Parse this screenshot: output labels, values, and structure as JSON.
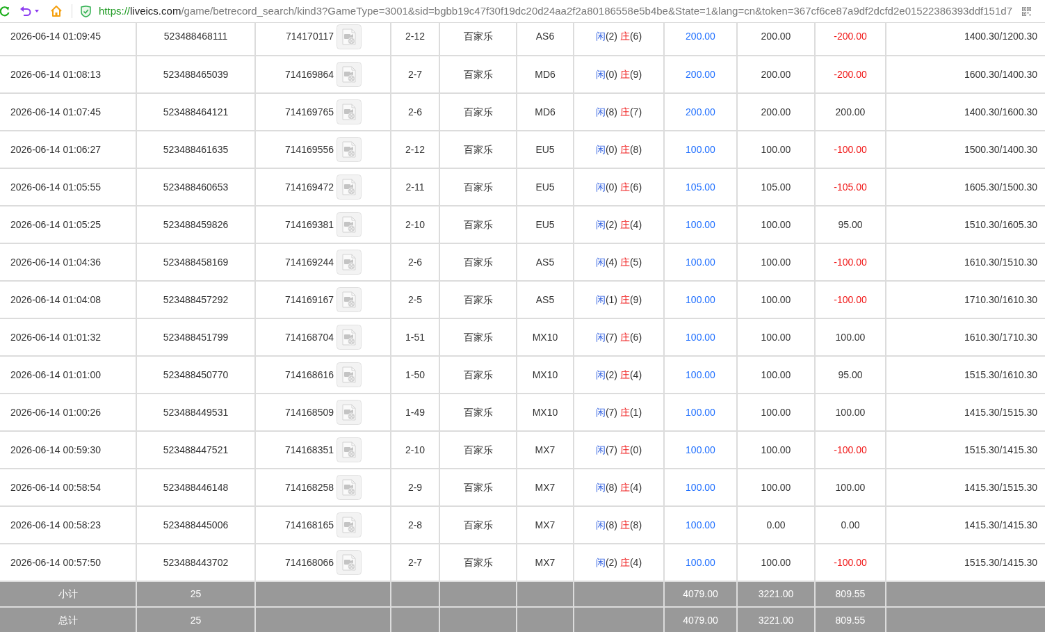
{
  "browser": {
    "url": {
      "scheme": "https://",
      "host": "liveics.com",
      "rest": "/game/betrecord_search/kind3?GameType=3001&sid=bgbb19c47f30f19dc20d24aa2f2a80186558e5b4be&State=1&lang=cn&token=367cf6ce87a9df2dcfd2e01522386393ddf151d7"
    }
  },
  "rows": [
    {
      "column_1": "2026-06-14 01:09:45",
      "column_2": "523488468111",
      "column_3": "714170117",
      "column_4": "2-12",
      "column_5": "百家乐",
      "column_6": "AS6",
      "column_7": {
        "player": "闲",
        "player_points": "(2)",
        "banker": "庄",
        "banker_points": "(6)"
      },
      "column_8": "200.00",
      "column_9": "200.00",
      "column_10": {
        "text": "-200.00",
        "loss": true
      },
      "column_11": "1400.30/1200.30"
    },
    {
      "column_1": "2026-06-14 01:08:13",
      "column_2": "523488465039",
      "column_3": "714169864",
      "column_4": "2-7",
      "column_5": "百家乐",
      "column_6": "MD6",
      "column_7": {
        "player": "闲",
        "player_points": "(0)",
        "banker": "庄",
        "banker_points": "(9)"
      },
      "column_8": "200.00",
      "column_9": "200.00",
      "column_10": {
        "text": "-200.00",
        "loss": true
      },
      "column_11": "1600.30/1400.30"
    },
    {
      "column_1": "2026-06-14 01:07:45",
      "column_2": "523488464121",
      "column_3": "714169765",
      "column_4": "2-6",
      "column_5": "百家乐",
      "column_6": "MD6",
      "column_7": {
        "player": "闲",
        "player_points": "(8)",
        "banker": "庄",
        "banker_points": "(7)"
      },
      "column_8": "200.00",
      "column_9": "200.00",
      "column_10": {
        "text": "200.00",
        "loss": false
      },
      "column_11": "1400.30/1600.30"
    },
    {
      "column_1": "2026-06-14 01:06:27",
      "column_2": "523488461635",
      "column_3": "714169556",
      "column_4": "2-12",
      "column_5": "百家乐",
      "column_6": "EU5",
      "column_7": {
        "player": "闲",
        "player_points": "(0)",
        "banker": "庄",
        "banker_points": "(8)"
      },
      "column_8": "100.00",
      "column_9": "100.00",
      "column_10": {
        "text": "-100.00",
        "loss": true
      },
      "column_11": "1500.30/1400.30"
    },
    {
      "column_1": "2026-06-14 01:05:55",
      "column_2": "523488460653",
      "column_3": "714169472",
      "column_4": "2-11",
      "column_5": "百家乐",
      "column_6": "EU5",
      "column_7": {
        "player": "闲",
        "player_points": "(0)",
        "banker": "庄",
        "banker_points": "(6)"
      },
      "column_8": "105.00",
      "column_9": "105.00",
      "column_10": {
        "text": "-105.00",
        "loss": true
      },
      "column_11": "1605.30/1500.30"
    },
    {
      "column_1": "2026-06-14 01:05:25",
      "column_2": "523488459826",
      "column_3": "714169381",
      "column_4": "2-10",
      "column_5": "百家乐",
      "column_6": "EU5",
      "column_7": {
        "player": "闲",
        "player_points": "(2)",
        "banker": "庄",
        "banker_points": "(4)"
      },
      "column_8": "100.00",
      "column_9": "100.00",
      "column_10": {
        "text": "95.00",
        "loss": false
      },
      "column_11": "1510.30/1605.30"
    },
    {
      "column_1": "2026-06-14 01:04:36",
      "column_2": "523488458169",
      "column_3": "714169244",
      "column_4": "2-6",
      "column_5": "百家乐",
      "column_6": "AS5",
      "column_7": {
        "player": "闲",
        "player_points": "(4)",
        "banker": "庄",
        "banker_points": "(5)"
      },
      "column_8": "100.00",
      "column_9": "100.00",
      "column_10": {
        "text": "-100.00",
        "loss": true
      },
      "column_11": "1610.30/1510.30"
    },
    {
      "column_1": "2026-06-14 01:04:08",
      "column_2": "523488457292",
      "column_3": "714169167",
      "column_4": "2-5",
      "column_5": "百家乐",
      "column_6": "AS5",
      "column_7": {
        "player": "闲",
        "player_points": "(1)",
        "banker": "庄",
        "banker_points": "(9)"
      },
      "column_8": "100.00",
      "column_9": "100.00",
      "column_10": {
        "text": "-100.00",
        "loss": true
      },
      "column_11": "1710.30/1610.30"
    },
    {
      "column_1": "2026-06-14 01:01:32",
      "column_2": "523488451799",
      "column_3": "714168704",
      "column_4": "1-51",
      "column_5": "百家乐",
      "column_6": "MX10",
      "column_7": {
        "player": "闲",
        "player_points": "(7)",
        "banker": "庄",
        "banker_points": "(6)"
      },
      "column_8": "100.00",
      "column_9": "100.00",
      "column_10": {
        "text": "100.00",
        "loss": false
      },
      "column_11": "1610.30/1710.30"
    },
    {
      "column_1": "2026-06-14 01:01:00",
      "column_2": "523488450770",
      "column_3": "714168616",
      "column_4": "1-50",
      "column_5": "百家乐",
      "column_6": "MX10",
      "column_7": {
        "player": "闲",
        "player_points": "(2)",
        "banker": "庄",
        "banker_points": "(4)"
      },
      "column_8": "100.00",
      "column_9": "100.00",
      "column_10": {
        "text": "95.00",
        "loss": false
      },
      "column_11": "1515.30/1610.30"
    },
    {
      "column_1": "2026-06-14 01:00:26",
      "column_2": "523488449531",
      "column_3": "714168509",
      "column_4": "1-49",
      "column_5": "百家乐",
      "column_6": "MX10",
      "column_7": {
        "player": "闲",
        "player_points": "(7)",
        "banker": "庄",
        "banker_points": "(1)"
      },
      "column_8": "100.00",
      "column_9": "100.00",
      "column_10": {
        "text": "100.00",
        "loss": false
      },
      "column_11": "1415.30/1515.30"
    },
    {
      "column_1": "2026-06-14 00:59:30",
      "column_2": "523488447521",
      "column_3": "714168351",
      "column_4": "2-10",
      "column_5": "百家乐",
      "column_6": "MX7",
      "column_7": {
        "player": "闲",
        "player_points": "(7)",
        "banker": "庄",
        "banker_points": "(0)"
      },
      "column_8": "100.00",
      "column_9": "100.00",
      "column_10": {
        "text": "-100.00",
        "loss": true
      },
      "column_11": "1515.30/1415.30"
    },
    {
      "column_1": "2026-06-14 00:58:54",
      "column_2": "523488446148",
      "column_3": "714168258",
      "column_4": "2-9",
      "column_5": "百家乐",
      "column_6": "MX7",
      "column_7": {
        "player": "闲",
        "player_points": "(8)",
        "banker": "庄",
        "banker_points": "(4)"
      },
      "column_8": "100.00",
      "column_9": "100.00",
      "column_10": {
        "text": "100.00",
        "loss": false
      },
      "column_11": "1415.30/1515.30"
    },
    {
      "column_1": "2026-06-14 00:58:23",
      "column_2": "523488445006",
      "column_3": "714168165",
      "column_4": "2-8",
      "column_5": "百家乐",
      "column_6": "MX7",
      "column_7": {
        "player": "闲",
        "player_points": "(8)",
        "banker": "庄",
        "banker_points": "(8)"
      },
      "column_8": "100.00",
      "column_9": "0.00",
      "column_10": {
        "text": "0.00",
        "loss": false
      },
      "column_11": "1415.30/1415.30"
    },
    {
      "column_1": "2026-06-14 00:57:50",
      "column_2": "523488443702",
      "column_3": "714168066",
      "column_4": "2-7",
      "column_5": "百家乐",
      "column_6": "MX7",
      "column_7": {
        "player": "闲",
        "player_points": "(2)",
        "banker": "庄",
        "banker_points": "(4)"
      },
      "column_8": "100.00",
      "column_9": "100.00",
      "column_10": {
        "text": "-100.00",
        "loss": true
      },
      "column_11": "1515.30/1415.30"
    }
  ],
  "totals": [
    {
      "column_1": "小计",
      "column_2": "25",
      "column_8": "4079.00",
      "column_9": "3221.00",
      "column_10": "809.55"
    },
    {
      "column_1": "总计",
      "column_2": "25",
      "column_8": "4079.00",
      "column_9": "3221.00",
      "column_10": "809.55"
    }
  ]
}
